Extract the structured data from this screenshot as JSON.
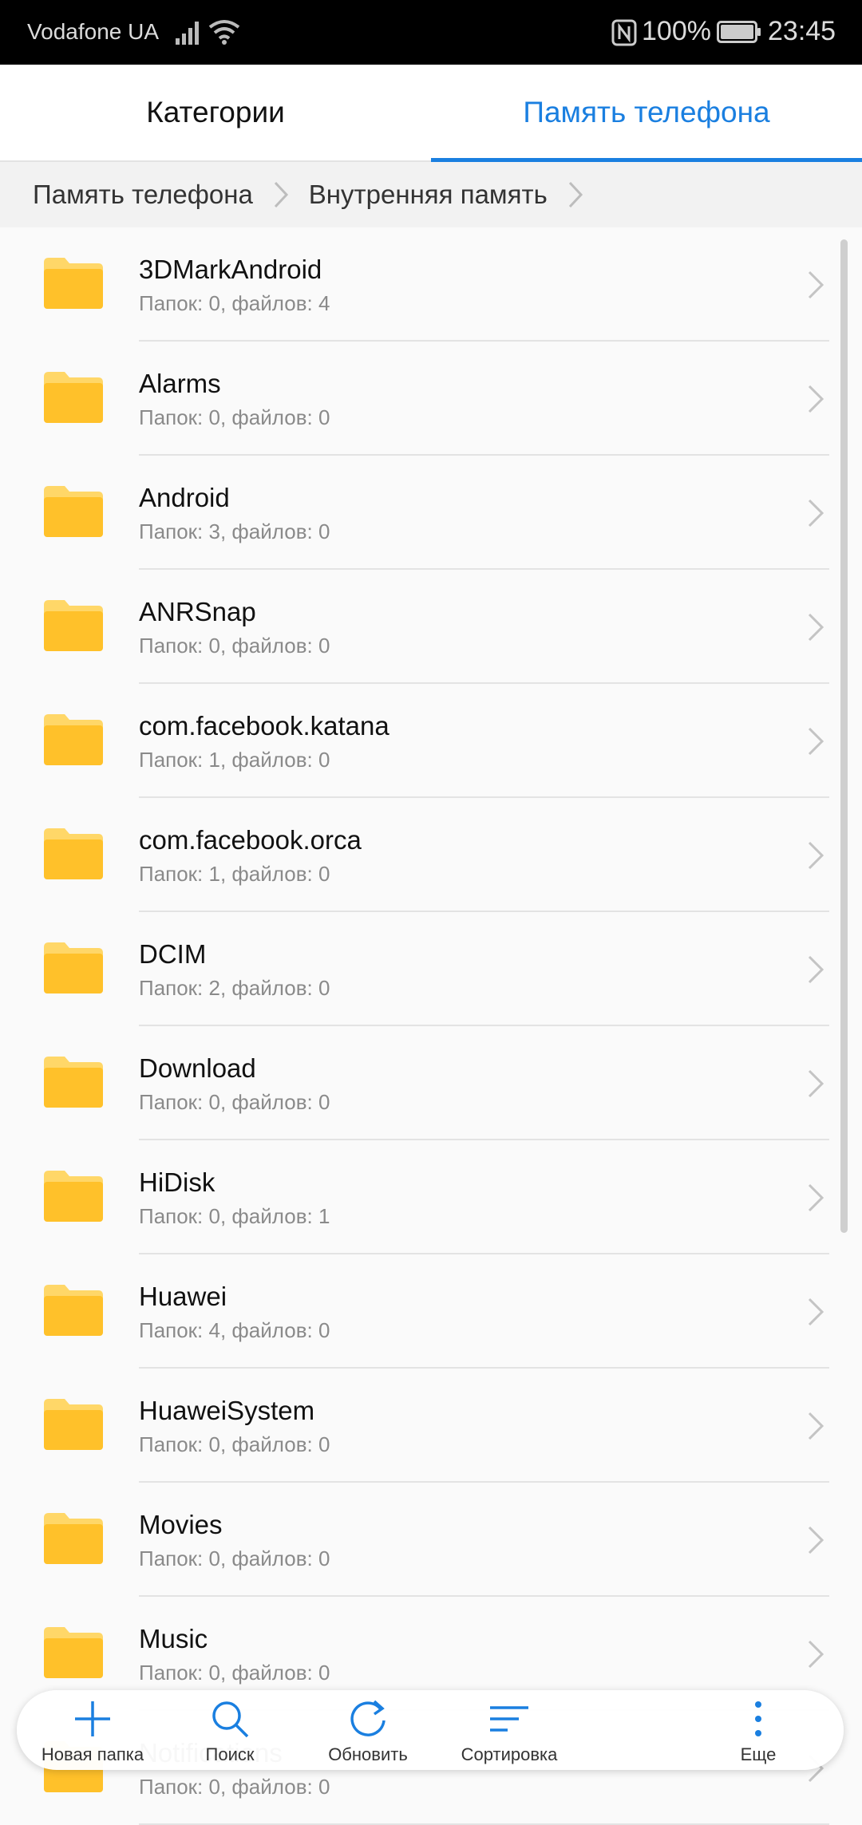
{
  "status_bar": {
    "carrier": "Vodafone UA",
    "battery": "100%",
    "time": "23:45"
  },
  "tabs": [
    {
      "label": "Категории",
      "active": false
    },
    {
      "label": "Память телефона",
      "active": true
    }
  ],
  "breadcrumb": [
    "Память телефона",
    "Внутренняя память"
  ],
  "folders": [
    {
      "name": "3DMarkAndroid",
      "meta": "Папок: 0, файлов: 4"
    },
    {
      "name": "Alarms",
      "meta": "Папок: 0, файлов: 0"
    },
    {
      "name": "Android",
      "meta": "Папок: 3, файлов: 0"
    },
    {
      "name": "ANRSnap",
      "meta": "Папок: 0, файлов: 0"
    },
    {
      "name": "com.facebook.katana",
      "meta": "Папок: 1, файлов: 0"
    },
    {
      "name": "com.facebook.orca",
      "meta": "Папок: 1, файлов: 0"
    },
    {
      "name": "DCIM",
      "meta": "Папок: 2, файлов: 0"
    },
    {
      "name": "Download",
      "meta": "Папок: 0, файлов: 0"
    },
    {
      "name": "HiDisk",
      "meta": "Папок: 0, файлов: 1"
    },
    {
      "name": "Huawei",
      "meta": "Папок: 4, файлов: 0"
    },
    {
      "name": "HuaweiSystem",
      "meta": "Папок: 0, файлов: 0"
    },
    {
      "name": "Movies",
      "meta": "Папок: 0, файлов: 0"
    },
    {
      "name": "Music",
      "meta": "Папок: 0, файлов: 0"
    },
    {
      "name": "Notifications",
      "meta": "Папок: 0, файлов: 0"
    }
  ],
  "toolbar": [
    {
      "label": "Новая папка",
      "icon": "plus-icon"
    },
    {
      "label": "Поиск",
      "icon": "search-icon"
    },
    {
      "label": "Обновить",
      "icon": "refresh-icon"
    },
    {
      "label": "Сортировка",
      "icon": "sort-icon"
    },
    {
      "label": "Еще",
      "icon": "more-vert-icon"
    }
  ],
  "colors": {
    "accent": "#1a7fe0",
    "folder": "#ffc12a",
    "folder_tab": "#ffd768"
  }
}
